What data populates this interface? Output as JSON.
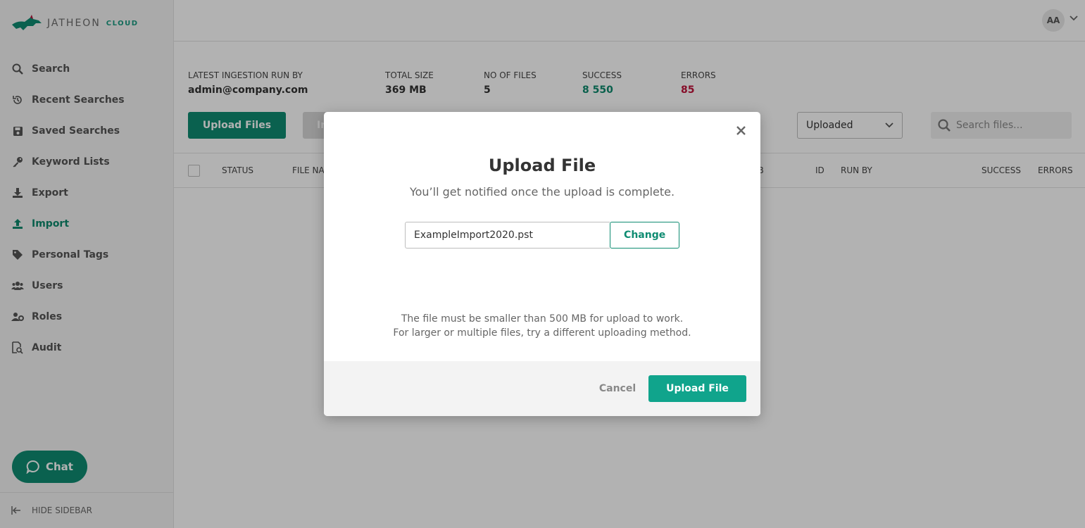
{
  "brand": {
    "name": "JATHEON",
    "suffix": "CLOUD"
  },
  "sidebar": {
    "items": [
      {
        "label": "Search",
        "icon": "search-icon"
      },
      {
        "label": "Recent Searches",
        "icon": "history-icon"
      },
      {
        "label": "Saved Searches",
        "icon": "save-icon"
      },
      {
        "label": "Keyword Lists",
        "icon": "key-icon"
      },
      {
        "label": "Export",
        "icon": "export-icon"
      },
      {
        "label": "Import",
        "icon": "import-icon",
        "active": true
      },
      {
        "label": "Personal Tags",
        "icon": "tag-icon"
      },
      {
        "label": "Users",
        "icon": "users-icon"
      },
      {
        "label": "Roles",
        "icon": "roles-icon"
      },
      {
        "label": "Audit",
        "icon": "audit-icon"
      }
    ],
    "chat_label": "Chat",
    "hide_label": "HIDE SIDEBAR"
  },
  "header": {
    "avatar_initials": "AA"
  },
  "stats": {
    "run_by_label": "LATEST INGESTION RUN BY",
    "run_by_value": "admin@company.com",
    "size_label": "TOTAL SIZE",
    "size_value": "369 MB",
    "files_label": "NO OF FILES",
    "files_value": "5",
    "success_label": "SUCCESS",
    "success_value": "8 550",
    "errors_label": "ERRORS",
    "errors_value": "85"
  },
  "toolbar": {
    "upload_label": "Upload Files",
    "second_label": "In",
    "filter_value": "Uploaded",
    "search_placeholder": "Search files..."
  },
  "table": {
    "columns": [
      "STATUS",
      "FILE NAI",
      "IB",
      "ID",
      "RUN BY",
      "SUCCESS",
      "ERRORS"
    ]
  },
  "modal": {
    "title": "Upload File",
    "subtitle": "You’ll get notified once the upload is complete.",
    "file_name": "ExampleImport2020.pst",
    "change_label": "Change",
    "note_line1": "The file must be smaller than 500 MB for upload to work.",
    "note_line2": "For larger or multiple files, try a different uploading method.",
    "cancel_label": "Cancel",
    "submit_label": "Upload File"
  },
  "colors": {
    "accent": "#0f8c72",
    "error": "#c0143c"
  }
}
